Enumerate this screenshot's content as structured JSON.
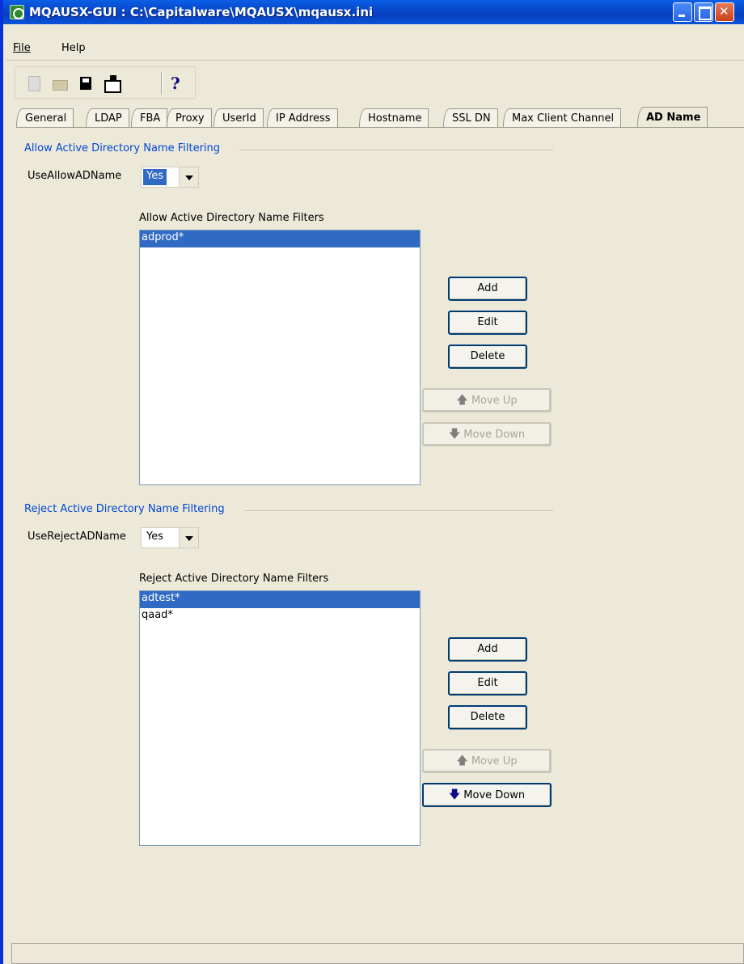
{
  "window": {
    "title": "MQAUSX-GUI : C:\\Capitalware\\MQAUSX\\mqausx.ini"
  },
  "menu": {
    "file": "File",
    "help": "Help"
  },
  "toolbar": {
    "new": "new-file-icon",
    "open": "open-folder-icon",
    "save": "save-disk-icon",
    "saveas": "save-as-icon",
    "help": "?"
  },
  "tabs": [
    {
      "label": "General"
    },
    {
      "label": "LDAP"
    },
    {
      "label": "FBA"
    },
    {
      "label": "Proxy"
    },
    {
      "label": "UserId"
    },
    {
      "label": "IP Address"
    },
    {
      "label": "Hostname"
    },
    {
      "label": "SSL DN"
    },
    {
      "label": "Max Client Channel"
    },
    {
      "label": "AD Name"
    }
  ],
  "active_tab": "AD Name",
  "allow": {
    "section_title": "Allow Active Directory Name Filtering",
    "field_label": "UseAllowADName",
    "value": "Yes",
    "list_label": "Allow Active Directory Name Filters",
    "items": [
      "adprod*"
    ],
    "buttons": {
      "add": "Add",
      "edit": "Edit",
      "delete": "Delete",
      "move_up": "Move Up",
      "move_down": "Move Down"
    }
  },
  "reject": {
    "section_title": "Reject Active Directory Name Filtering",
    "field_label": "UseRejectADName",
    "value": "Yes",
    "list_label": "Reject Active Directory Name Filters",
    "items": [
      "adtest*",
      "qaad*"
    ],
    "buttons": {
      "add": "Add",
      "edit": "Edit",
      "delete": "Delete",
      "move_up": "Move Up",
      "move_down": "Move Down"
    }
  },
  "colors": {
    "title_bar": "#0a5fe6",
    "section_title": "#0046d5",
    "selection": "#316ac5",
    "window_bg": "#ece9d8"
  }
}
